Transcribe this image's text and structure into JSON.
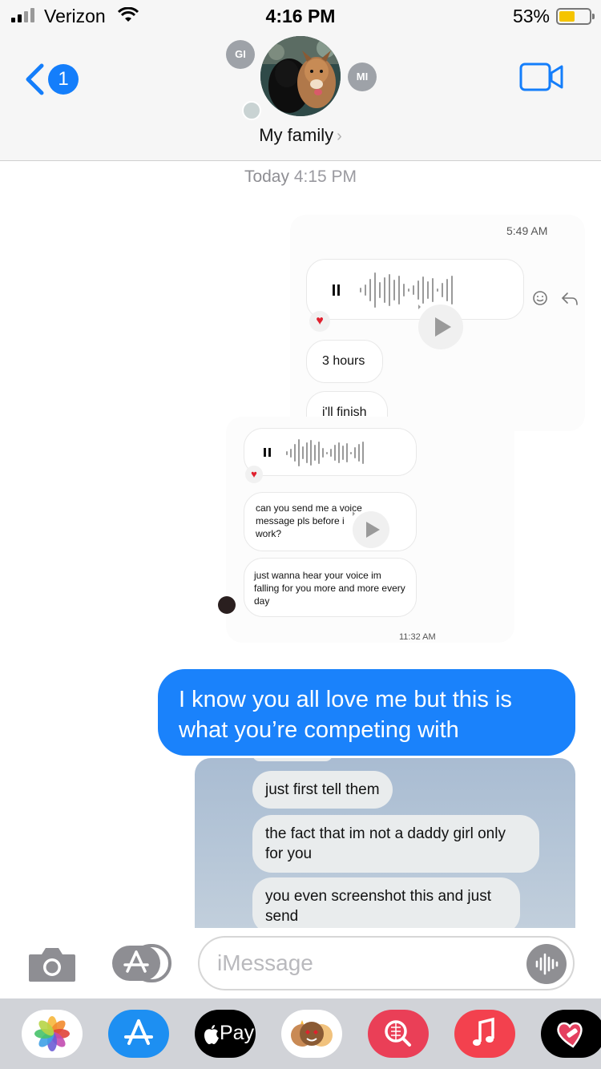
{
  "status_bar": {
    "carrier": "Verizon",
    "time": "4:16 PM",
    "battery_percent": "53%",
    "battery_level": 0.53,
    "battery_color": "#f5c400"
  },
  "header": {
    "back_badge": "1",
    "group_name": "My family",
    "members": [
      "GI",
      "MI"
    ],
    "accent_color": "#147efb"
  },
  "thread": {
    "timestamp_day": "Today",
    "timestamp_time": "4:15 PM"
  },
  "screenshot1": {
    "time": "5:49 AM",
    "messages": [
      "3 hours",
      "i'll finish"
    ]
  },
  "screenshot2": {
    "messages": [
      "can you send me a voice message pls before i work?",
      "just wanna hear your voice im falling for you more and more every day"
    ],
    "time": "11:32 AM"
  },
  "outgoing_message": {
    "text": "I know you all love me but this is what you’re competing with",
    "bubble_color": "#1a82fb"
  },
  "screenshot3": {
    "messages": [
      "just first tell them",
      "the fact that im not a daddy girl only for you",
      "you even screenshot this and just send"
    ]
  },
  "input_bar": {
    "placeholder": "iMessage"
  },
  "app_drawer": {
    "apps": [
      "photos-icon",
      "app-store-icon",
      "apple-pay-icon",
      "memoji-icon",
      "search-images-icon",
      "music-icon",
      "heart-sticker-icon"
    ],
    "apple_pay_label": "Pay"
  }
}
